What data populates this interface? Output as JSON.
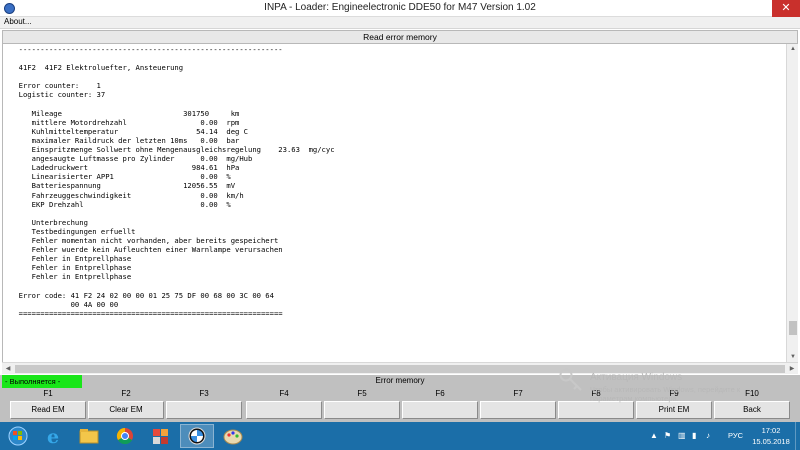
{
  "window": {
    "title": "INPA - Loader:  Engineelectronic DDE50 for M47 Version 1.02",
    "close_glyph": "✕",
    "menu": [
      "About..."
    ]
  },
  "screen": {
    "header": "Read error memory",
    "lines": [
      "  -------------------------------------------------------------",
      "",
      "  41F2  41F2 Elektroluefter, Ansteuerung",
      "",
      "  Error counter:    1",
      "  Logistic counter: 37",
      "",
      "     Mileage                            301750     km",
      "     mittlere Motordrehzahl                 0.00  rpm",
      "     Kuhlmitteltemperatur                  54.14  deg C",
      "     maximaler Raildruck der letzten 10ms   0.00  bar",
      "     Einspritzmenge Sollwert ohne Mengenausgleichsregelung    23.63  mg/cyc",
      "     angesaugte Luftmasse pro Zylinder      0.00  mg/Hub",
      "     Ladedruckwert                        984.61  hPa",
      "     Linearisierter APP1                    0.00  %",
      "     Batteriespannung                   12056.55  mV",
      "     Fahrzeuggeschwindigkeit                0.00  km/h",
      "     EKP Drehzahl                           0.00  %",
      "",
      "     Unterbrechung",
      "     Testbedingungen erfuellt",
      "     Fehler momentan nicht vorhanden, aber bereits gespeichert",
      "     Fehler wuerde kein Aufleuchten einer Warnlampe verursachen",
      "     Fehler in Entprellphase",
      "     Fehler in Entprellphase",
      "     Fehler in Entprellphase",
      "",
      "  Error code: 41 F2 24 02 00 00 01 25 75 DF 00 68 00 3C 00 64",
      "              00 4A 00 00",
      "  ============================================================="
    ]
  },
  "status": {
    "running": "- Выполняется -",
    "label": "Error memory"
  },
  "fkeys": [
    {
      "key": "F1",
      "label": "Read EM"
    },
    {
      "key": "F2",
      "label": "Clear EM"
    },
    {
      "key": "F3",
      "label": ""
    },
    {
      "key": "F4",
      "label": ""
    },
    {
      "key": "F5",
      "label": ""
    },
    {
      "key": "F6",
      "label": ""
    },
    {
      "key": "F7",
      "label": ""
    },
    {
      "key": "F8",
      "label": ""
    },
    {
      "key": "F9",
      "label": "Print EM"
    },
    {
      "key": "F10",
      "label": "Back"
    }
  ],
  "watermark": {
    "title": "Активация Windows",
    "line1": "Чтобы активировать Windows, перейдите к",
    "line2": "параметрам компьютера."
  },
  "taskbar": {
    "items": [
      "start-icon",
      "internet-explorer-icon",
      "file-explorer-icon",
      "chrome-icon",
      "puzzle-app-icon",
      "bmw-inpa-icon",
      "paint-icon"
    ],
    "active_index": 5,
    "tray": {
      "lang": "РУС",
      "time": "17:02",
      "date": "15.05.2018"
    }
  },
  "colors": {
    "status_running_bg": "#19e619",
    "taskbar_bg": "#1b6ea8",
    "close_bg": "#c9302c"
  }
}
